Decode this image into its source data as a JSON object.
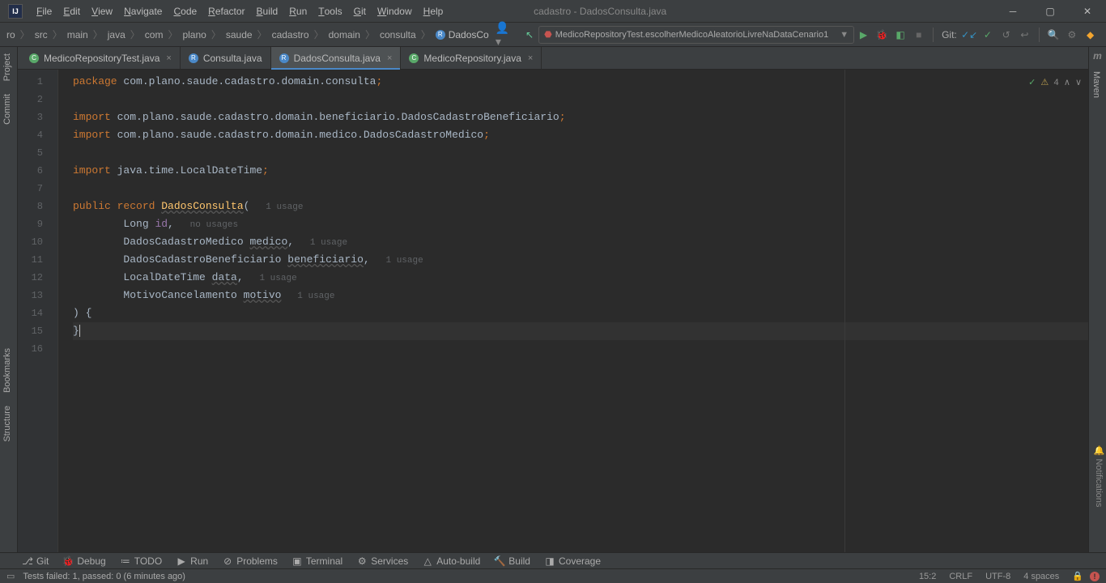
{
  "window": {
    "title": "cadastro - DadosConsulta.java"
  },
  "menu": [
    "File",
    "Edit",
    "View",
    "Navigate",
    "Code",
    "Refactor",
    "Build",
    "Run",
    "Tools",
    "Git",
    "Window",
    "Help"
  ],
  "breadcrumbs": [
    "ro",
    "src",
    "main",
    "java",
    "com",
    "plano",
    "saude",
    "cadastro",
    "domain",
    "consulta",
    "DadosConsulta"
  ],
  "runconfig": {
    "label": "MedicoRepositoryTest.escolherMedicoAleatorioLivreNaDataCenario1"
  },
  "git": {
    "label": "Git:"
  },
  "tabs": [
    {
      "label": "MedicoRepositoryTest.java",
      "color": "#59a869",
      "active": false,
      "closable": true
    },
    {
      "label": "Consulta.java",
      "color": "#4a88c7",
      "active": false,
      "closable": false
    },
    {
      "label": "DadosConsulta.java",
      "color": "#4a88c7",
      "active": true,
      "closable": true
    },
    {
      "label": "MedicoRepository.java",
      "color": "#59a869",
      "active": false,
      "closable": true
    }
  ],
  "leftTools": [
    "Project",
    "Commit",
    "Bookmarks",
    "Structure"
  ],
  "rightTools": [
    "m",
    "Maven",
    "Notifications"
  ],
  "inspections": {
    "warnings": "4"
  },
  "code": {
    "lines": [
      "1",
      "2",
      "3",
      "4",
      "5",
      "6",
      "7",
      "8",
      "9",
      "10",
      "11",
      "12",
      "13",
      "14",
      "15",
      "16"
    ],
    "l1_kw": "package",
    "l1_pkg": " com.plano.saude.cadastro.domain.consulta",
    "l3_kw": "import",
    "l3_pkg": " com.plano.saude.cadastro.domain.beneficiario.DadosCadastroBeneficiario",
    "l4_kw": "import",
    "l4_pkg": " com.plano.saude.cadastro.domain.medico.DadosCadastroMedico",
    "l6_kw": "import",
    "l6_pkg": " java.time.LocalDateTime",
    "l8_pub": "public ",
    "l8_rec": "record ",
    "l8_name": "DadosConsulta",
    "l8_open": "(",
    "l8_hint": "   1 usage",
    "l9_indent": "        ",
    "l9_type": "Long ",
    "l9_fld": "id",
    "l9_c": ",",
    "l9_hint": "   no usages",
    "l10_indent": "        ",
    "l10_type": "DadosCadastroMedico ",
    "l10_fld": "medico",
    "l10_c": ",",
    "l10_hint": "   1 usage",
    "l11_indent": "        ",
    "l11_type": "DadosCadastroBeneficiario ",
    "l11_fld": "beneficiario",
    "l11_c": ",",
    "l11_hint": "   1 usage",
    "l12_indent": "        ",
    "l12_type": "LocalDateTime ",
    "l12_fld": "data",
    "l12_c": ",",
    "l12_hint": "   1 usage",
    "l13_indent": "        ",
    "l13_type": "MotivoCancelamento ",
    "l13_fld": "motivo",
    "l13_hint": "   1 usage",
    "l14": ") {",
    "l15": "}"
  },
  "bottomTools": [
    {
      "icon": "⎇",
      "label": "Git"
    },
    {
      "icon": "🐞",
      "label": "Debug"
    },
    {
      "icon": "≔",
      "label": "TODO"
    },
    {
      "icon": "▶",
      "label": "Run"
    },
    {
      "icon": "⊘",
      "label": "Problems"
    },
    {
      "icon": "▣",
      "label": "Terminal"
    },
    {
      "icon": "⚙",
      "label": "Services"
    },
    {
      "icon": "△",
      "label": "Auto-build"
    },
    {
      "icon": "🔨",
      "label": "Build"
    },
    {
      "icon": "◨",
      "label": "Coverage"
    }
  ],
  "status": {
    "msg": "Tests failed: 1, passed: 0 (6 minutes ago)",
    "pos": "15:2",
    "eol": "CRLF",
    "enc": "UTF-8",
    "indent": "4 spaces"
  }
}
